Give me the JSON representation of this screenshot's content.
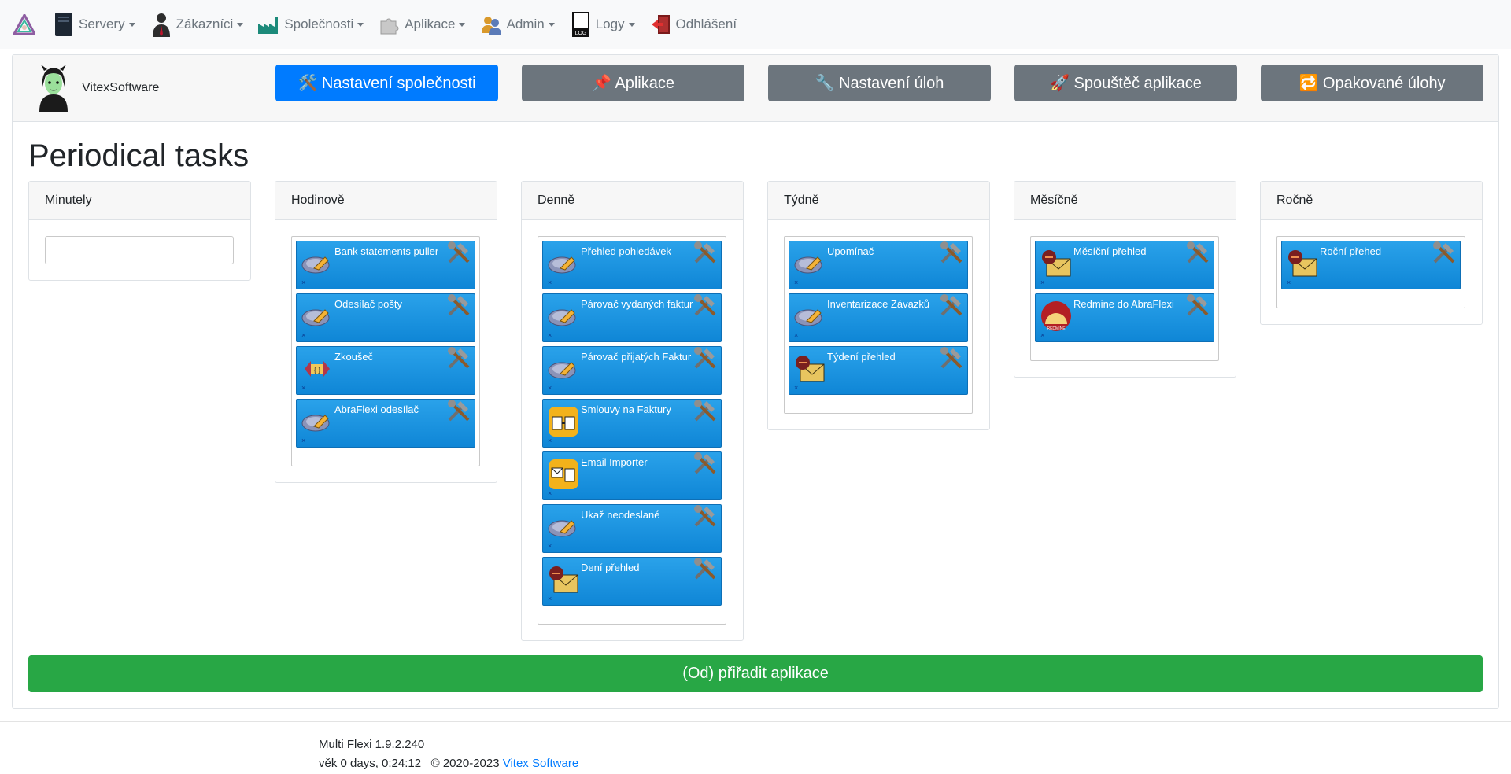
{
  "nav": {
    "items": [
      {
        "label": "Servery",
        "icon": "server-icon",
        "dropdown": true
      },
      {
        "label": "Zákazníci",
        "icon": "customer-icon",
        "dropdown": true
      },
      {
        "label": "Společnosti",
        "icon": "factory-icon",
        "dropdown": true
      },
      {
        "label": "Aplikace",
        "icon": "puzzle-icon",
        "dropdown": true
      },
      {
        "label": "Admin",
        "icon": "users-icon",
        "dropdown": true
      },
      {
        "label": "Logy",
        "icon": "log-icon",
        "dropdown": true
      },
      {
        "label": "Odhlášení",
        "icon": "logout-icon",
        "dropdown": false
      }
    ]
  },
  "company": {
    "name": "VitexSoftware"
  },
  "header_buttons": [
    {
      "label": "🛠️ Nastavení společnosti",
      "style": "primary"
    },
    {
      "label": "📌 Aplikace",
      "style": "secondary"
    },
    {
      "label": "🔧 Nastavení úloh",
      "style": "secondary"
    },
    {
      "label": "🚀 Spouštěč aplikace",
      "style": "secondary"
    },
    {
      "label": "🔁 Opakované úlohy",
      "style": "secondary"
    }
  ],
  "page_title": "Periodical tasks",
  "columns": [
    {
      "title": "Minutely",
      "title_text": "Minutely",
      "jobs": []
    },
    {
      "title": "Hodinově",
      "jobs": [
        {
          "label": "Bank statements puller",
          "icon": "abraflexi-icon"
        },
        {
          "label": "Odesílač pošty",
          "icon": "abraflexi-icon"
        },
        {
          "label": "Zkoušeč",
          "icon": "tester-icon"
        },
        {
          "label": "AbraFlexi odesílač",
          "icon": "abraflexi-icon"
        }
      ]
    },
    {
      "title": "Denně",
      "jobs": [
        {
          "label": "Přehled pohledávek",
          "icon": "abraflexi-icon"
        },
        {
          "label": "Párovač vydaných faktur",
          "icon": "abraflexi-icon"
        },
        {
          "label": "Párovač přijatých Faktur",
          "icon": "abraflexi-icon"
        },
        {
          "label": "Smlouvy na Faktury",
          "icon": "contract-icon"
        },
        {
          "label": "Email Importer",
          "icon": "email-importer-icon"
        },
        {
          "label": "Ukaž neodeslané",
          "icon": "abraflexi-icon"
        },
        {
          "label": "Dení přehled",
          "icon": "mail-report-icon"
        }
      ]
    },
    {
      "title": "Týdně",
      "jobs": [
        {
          "label": "Upomínač",
          "icon": "abraflexi-icon"
        },
        {
          "label": "Inventarizace Závazků",
          "icon": "abraflexi-icon"
        },
        {
          "label": "Týdení přehled",
          "icon": "mail-report-icon"
        }
      ]
    },
    {
      "title": "Měsíčně",
      "jobs": [
        {
          "label": "Měsíční přehled",
          "icon": "mail-report-icon"
        },
        {
          "label": "Redmine do AbraFlexi",
          "icon": "redmine-icon"
        }
      ]
    },
    {
      "title": "Ročně",
      "jobs": [
        {
          "label": "Roční přehed",
          "icon": "mail-report-icon"
        }
      ]
    }
  ],
  "assign_button": "(Od) přiřadit aplikace",
  "footer": {
    "version": "Multi Flexi 1.9.2.240",
    "uptime": "věk 0 days, 0:24:12",
    "copyright": "© 2020-2023",
    "link": "Vitex Software"
  },
  "colors": {
    "primary": "#007bff",
    "secondary": "#6c757d",
    "success": "#28a745",
    "job": "#1a94e0"
  }
}
